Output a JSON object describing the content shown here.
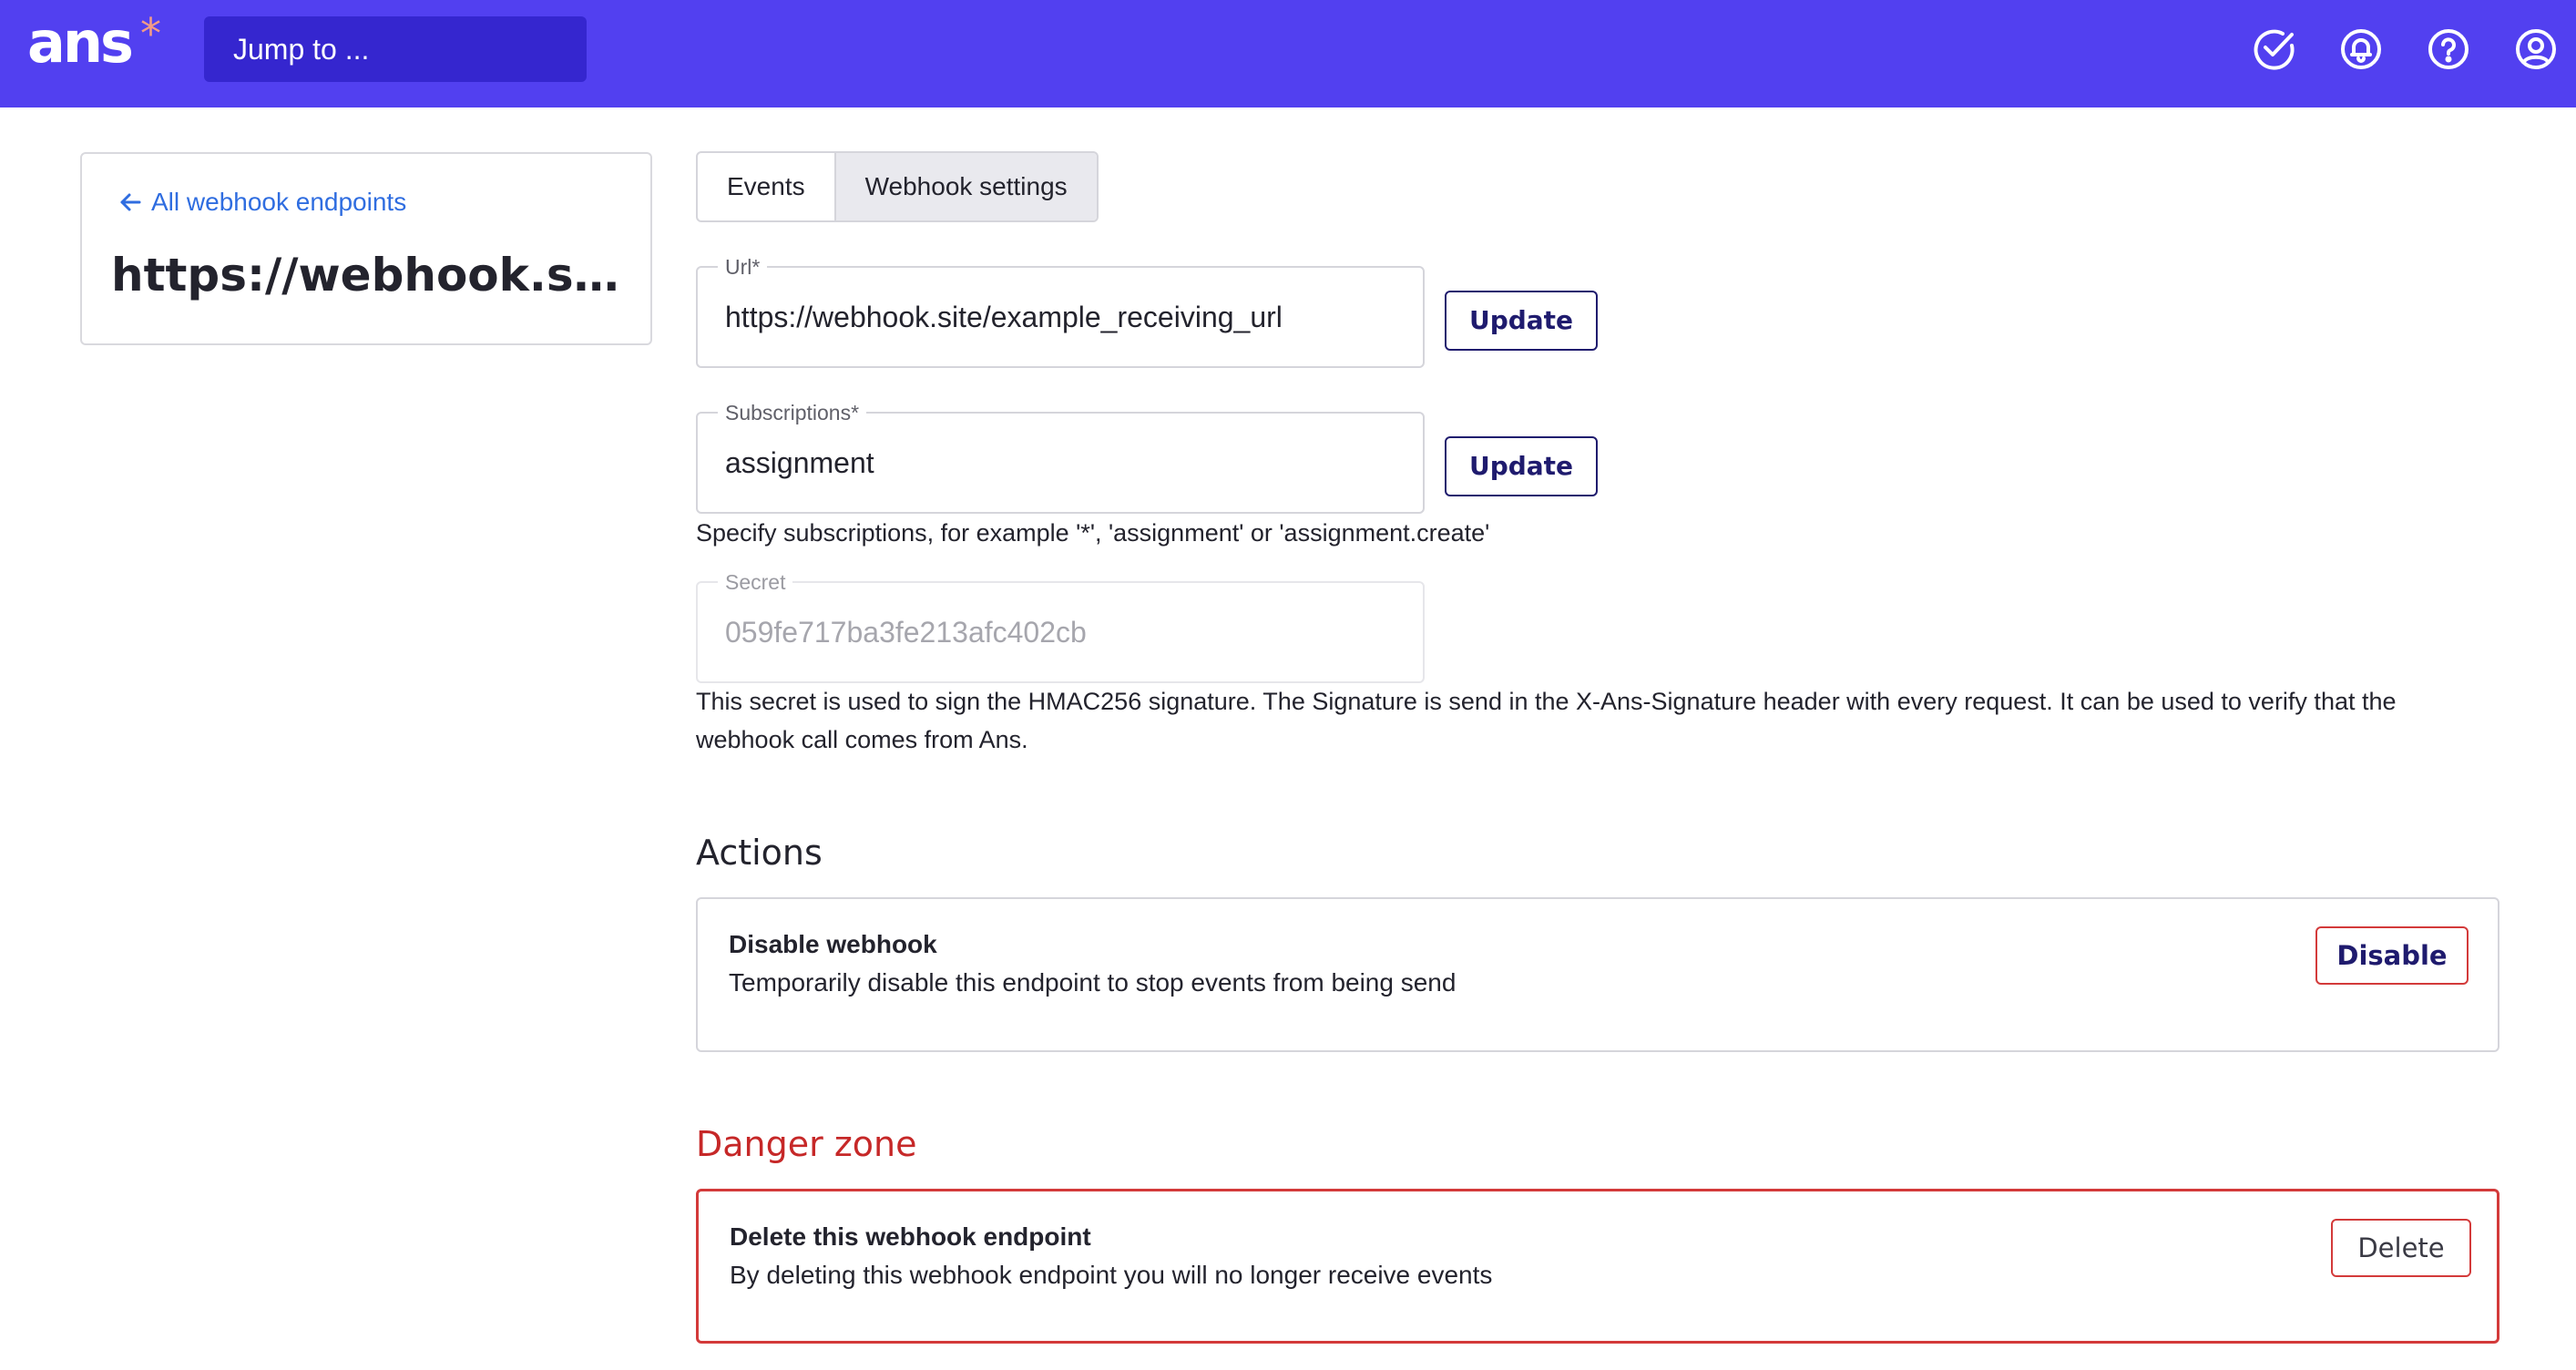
{
  "header": {
    "logo": "ans",
    "logo_mark": "*",
    "jump_placeholder": "Jump to ...",
    "icons": [
      "check-circle-icon",
      "bell-icon",
      "help-icon",
      "user-icon"
    ]
  },
  "sidebar": {
    "back_link": "All webhook endpoints",
    "endpoint_title": "https://webhook.site/example_receiving_url"
  },
  "tabs": [
    {
      "label": "Events",
      "active": false
    },
    {
      "label": "Webhook settings",
      "active": true
    }
  ],
  "form": {
    "url": {
      "label": "Url*",
      "value": "https://webhook.site/example_receiving_url",
      "button": "Update"
    },
    "subscriptions": {
      "label": "Subscriptions*",
      "value": "assignment",
      "button": "Update",
      "help": "Specify subscriptions, for example '*', 'assignment' or 'assignment.create'"
    },
    "secret": {
      "label": "Secret",
      "value": "059fe717ba3fe213afc402cb",
      "help": "This secret is used to sign the HMAC256 signature. The Signature is send in the X-Ans-Signature header with every request. It can be used to verify that the webhook call comes from Ans."
    }
  },
  "actions": {
    "heading": "Actions",
    "disable": {
      "title": "Disable webhook",
      "description": "Temporarily disable this endpoint to stop events from being send",
      "button": "Disable"
    }
  },
  "danger": {
    "heading": "Danger zone",
    "delete": {
      "title": "Delete this webhook endpoint",
      "description": "By deleting this webhook endpoint you will no longer receive events",
      "button": "Delete"
    }
  },
  "colors": {
    "brand": "#5240f0",
    "brand_dark": "#3526cf",
    "link": "#2f6de0",
    "danger": "#c62828",
    "button_text": "#1f1b6e"
  }
}
